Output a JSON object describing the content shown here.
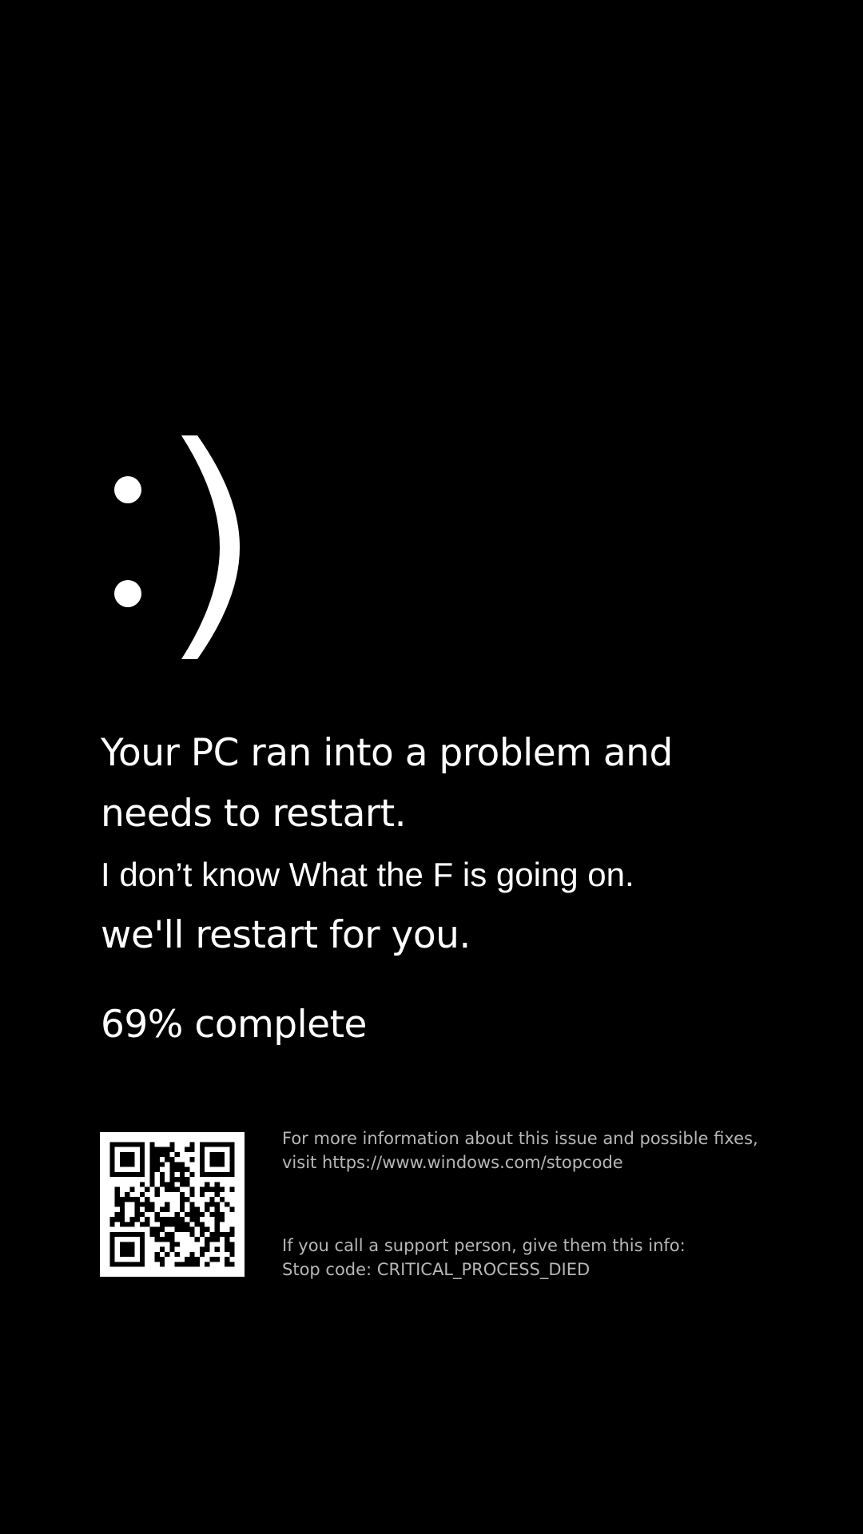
{
  "screen": {
    "background_color": "#000000",
    "text_color": "#ffffff",
    "secondary_text_color": "#b7b7b7"
  },
  "face": {
    "text": ":)",
    "icon": "smiley-emoticon-icon"
  },
  "message": {
    "line1": "Your PC ran into a problem and",
    "line2": "needs to restart.",
    "line3": "I don’t know What the F is going on.",
    "line4": "we'll restart for you."
  },
  "progress": {
    "text": "69% complete",
    "percent": 69
  },
  "qr_code": {
    "icon": "qr-code-icon"
  },
  "more_info": {
    "line1": "For more information about this issue and possible fixes,",
    "line2": "visit https://www.windows.com/stopcode"
  },
  "support": {
    "line1": "If you call a support person, give them this info:",
    "line2": "Stop code: CRITICAL_PROCESS_DIED"
  }
}
